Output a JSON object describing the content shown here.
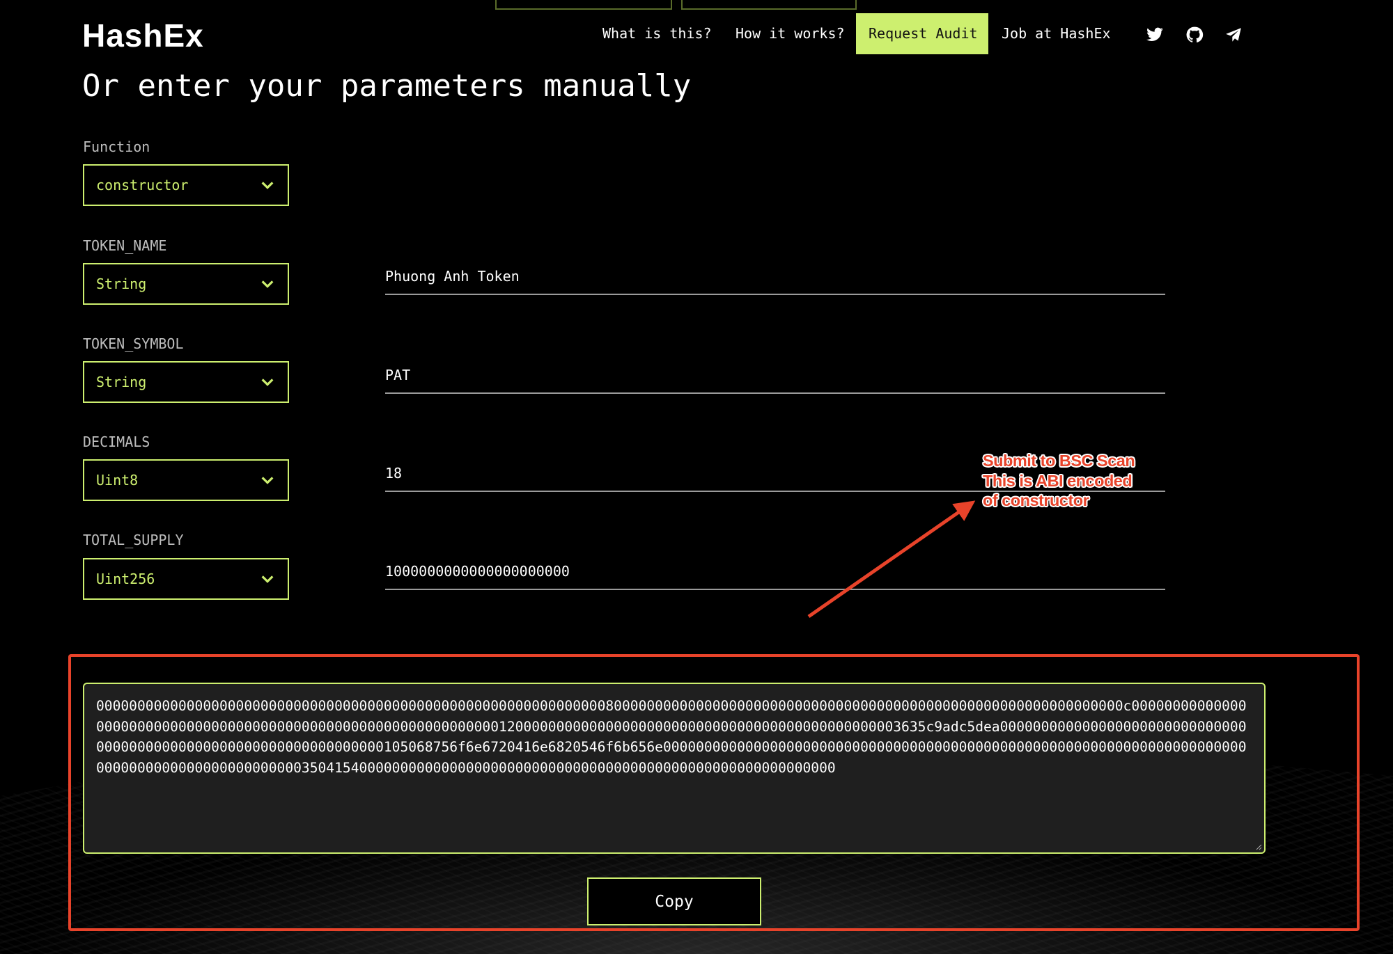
{
  "header": {
    "logo": "HashEx",
    "nav": [
      {
        "label": "What is this?"
      },
      {
        "label": "How it works?"
      },
      {
        "label": "Request Audit"
      },
      {
        "label": "Job at HashEx"
      }
    ],
    "social_icons": [
      "twitter-icon",
      "github-icon",
      "telegram-icon"
    ]
  },
  "page": {
    "title": "Or enter your parameters manually"
  },
  "form": {
    "function": {
      "label": "Function",
      "selected": "constructor"
    },
    "params": [
      {
        "label": "TOKEN_NAME",
        "type": "String",
        "value": "Phuong Anh Token"
      },
      {
        "label": "TOKEN_SYMBOL",
        "type": "String",
        "value": "PAT"
      },
      {
        "label": "DECIMALS",
        "type": "Uint8",
        "value": "18"
      },
      {
        "label": "TOTAL_SUPPLY",
        "type": "Uint256",
        "value": "1000000000000000000000"
      }
    ]
  },
  "output": {
    "encoded": "00000000000000000000000000000000000000000000000000000000000000800000000000000000000000000000000000000000000000000000000000000c0000000000000000000000000000000000000000000000000000000000000001200000000000000000000000000000000000000000000003635c9adc5dea00000000000000000000000000000000000000000000000000000000000000000105068756f6e6720416e6820546f6b656e00000000000000000000000000000000000000000000000000000000000000000000000000000000000000000000000035041540000000000000000000000000000000000000000000000000000000000",
    "copy_label": "Copy"
  },
  "annotation": {
    "lines": [
      "Submit to BSC Scan",
      "This is ABI encoded",
      "of constructor"
    ],
    "color": "#e8432a"
  },
  "colors": {
    "accent": "#cdef6f",
    "background": "#000000",
    "annotation_red": "#e8432a"
  }
}
